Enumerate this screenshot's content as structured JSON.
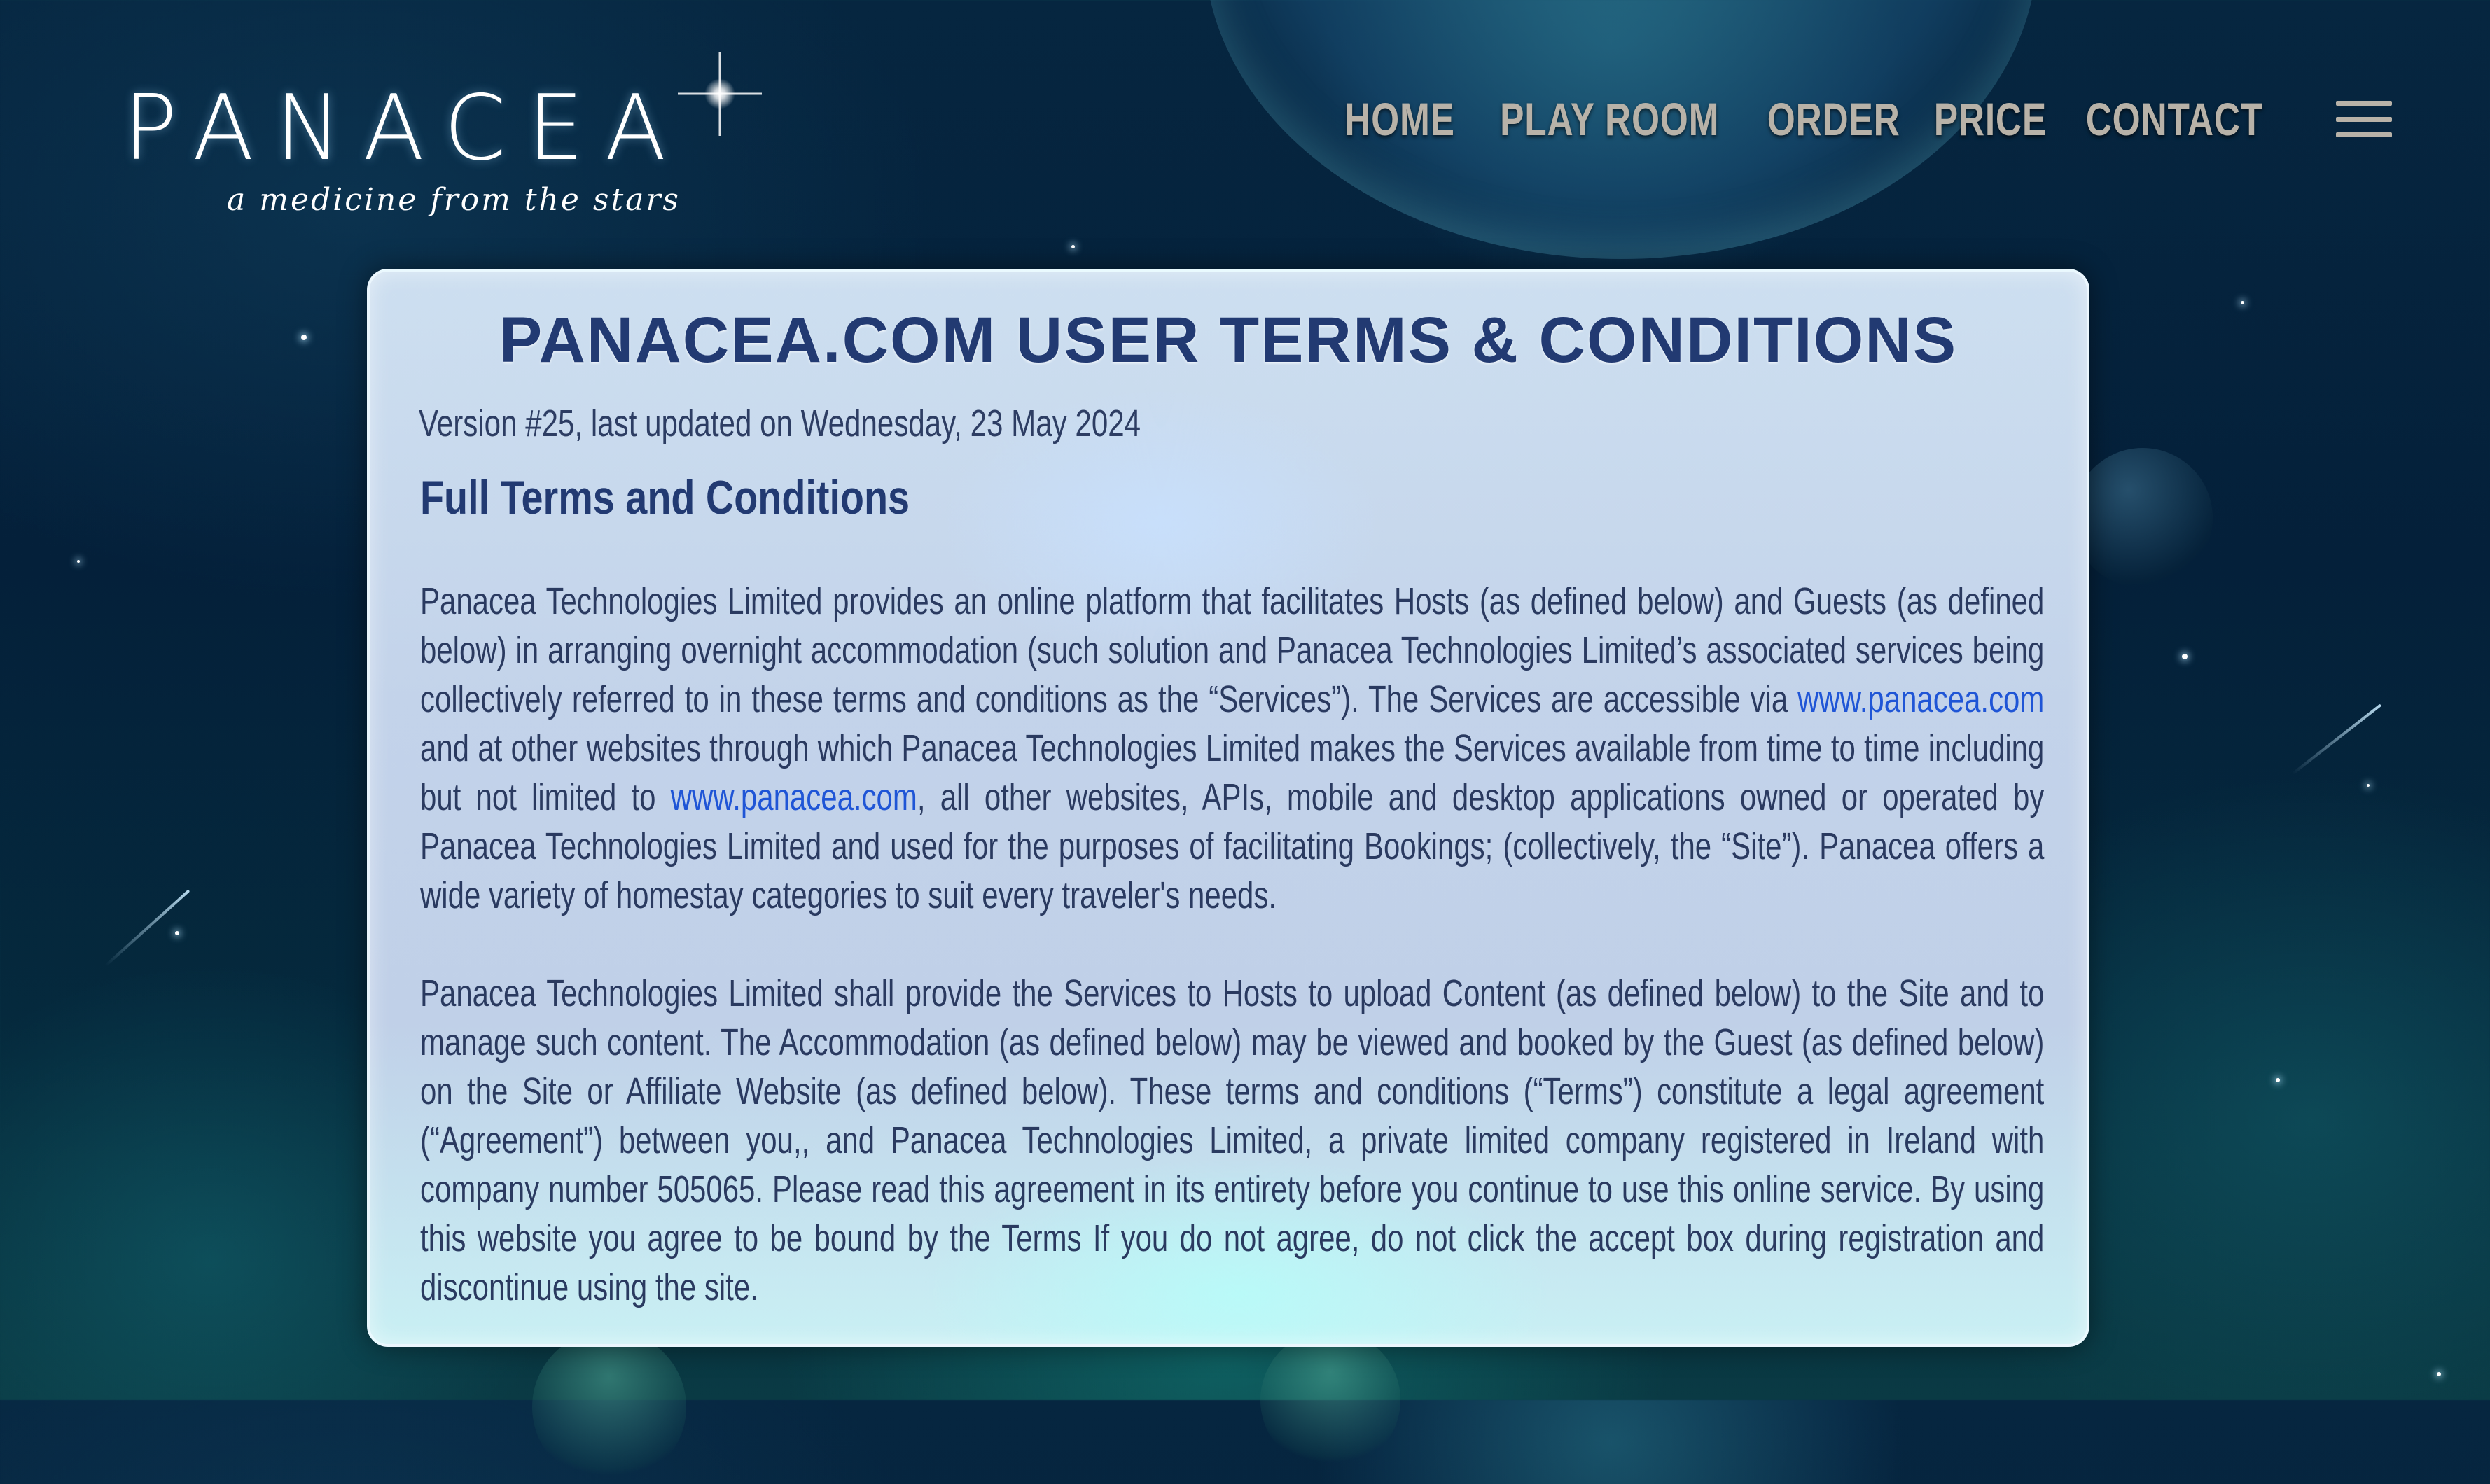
{
  "brand": {
    "name": "PANACEA",
    "tagline": "a medicine from the stars"
  },
  "nav": {
    "items": [
      {
        "label": "HOME"
      },
      {
        "label": "PLAY ROOM"
      },
      {
        "label": "ORDER"
      },
      {
        "label": "PRICE"
      },
      {
        "label": "CONTACT"
      }
    ],
    "menu_icon": "hamburger-menu-icon"
  },
  "terms": {
    "title": "PANACEA.COM USER TERMS & CONDITIONS",
    "version": "Version #25, last updated on Wednesday, 23 May 2024",
    "section_title": "Full Terms and Conditions",
    "paragraph1": {
      "part1": "Panacea Technologies Limited provides an online platform that facilitates Hosts (as defined below) and Guests (as defined below) in arranging overnight accommodation (such solution and Panacea Technologies Limited’s associated services being collectively referred to in these terms and conditions as the “Services”). The Services are accessible via ",
      "link1": "www.panacea.com",
      "part2": " and at other websites through which Panacea Technologies Limited makes the Services available from time to time including but not limited to ",
      "link2": "www.panacea.com",
      "part3": ", all other websites, APIs, mobile and desktop applications owned or operated by Panacea Technologies Limited and used for the purposes of facilitating Bookings; (collectively, the “Site”). Panacea offers a wide variety of homestay categories to suit every traveler's needs."
    },
    "paragraph2": "Panacea Technologies Limited shall provide the Services to Hosts to upload Content (as defined below) to the Site and to manage such content. The Accommodation (as defined below) may be viewed and booked by the Guest (as defined below) on the Site or Affiliate Website (as defined below). These terms and conditions (“Terms”) constitute a legal agreement (“Agreement”) between you,, and Panacea Technologies Limited, a private limited company registered in Ireland with company number 505065. Please read this agreement in its entirety before you continue to use this online service. By using this website you agree to be bound by the Terms If you do not agree, do not click the accept box during registration and discontinue using the site."
  },
  "colors": {
    "title": "#223a72",
    "link": "#1f55d6",
    "nav": "#b8b2a8",
    "background": "#04203a"
  }
}
